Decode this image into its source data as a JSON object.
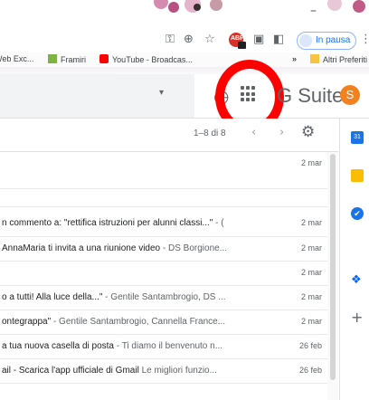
{
  "browser": {
    "window_controls": {
      "minimize": "–"
    },
    "omnibox_icons": {
      "key": "⚿",
      "zoom": "⊕",
      "star": "☆",
      "ext_red_text": "ABP",
      "ext_gray1": "▣",
      "ext_gray2": "◧",
      "menu": "⋮"
    },
    "profile": {
      "status_label": "In pausa"
    },
    "bookmarks": [
      {
        "label": "Web Exc...",
        "icon_color": "#ffffff"
      },
      {
        "label": "Framiri",
        "icon_color": "#7cb342"
      },
      {
        "label": "YouTube - Broadcas...",
        "icon_color": "#ff0000"
      }
    ],
    "bookmarks_overflow": "»",
    "other_bookmarks": "Altri Preferiti"
  },
  "gmail": {
    "header": {
      "search_dropdown_icon": "▾",
      "help_icon_partial": "◷",
      "apps_icon": "apps-grid-icon",
      "brand": "G Suite",
      "user_initial": "S",
      "avatar_color": "#f4811f"
    },
    "toolbar": {
      "paging": "1–8 di 8",
      "prev": "‹",
      "next": "›",
      "settings": "⚙"
    },
    "messages": [
      {
        "subject": "",
        "snippet": "",
        "date": "2 mar"
      },
      {
        "subject": "",
        "snippet": "",
        "date": ""
      },
      {
        "subject": "n commento a: \"rettifica istruzioni per alunni classi...\"",
        "snippet": " - (",
        "date": "2 mar"
      },
      {
        "subject": "AnnaMaria ti invita a una riunione video",
        "snippet": " - DS Borgione...",
        "date": "2 mar"
      },
      {
        "subject": "",
        "snippet": "",
        "date": "2 mar"
      },
      {
        "subject": "o a tutti! Alla luce della...\"",
        "snippet": " - Gentile Santambrogio, DS ...",
        "date": "2 mar"
      },
      {
        "subject": "ontegrappa\"",
        "snippet": " - Gentile Santambrogio, Cannella France...",
        "date": "2 mar"
      },
      {
        "subject": "a tua nuova casella di posta",
        "snippet": " - Ti diamo il benvenuto n...",
        "date": "26 feb"
      },
      {
        "subject": "ail - Scarica l'app ufficiale di Gmail",
        "snippet": " Le migliori funzio...",
        "date": "26 feb"
      }
    ]
  },
  "side_panel": {
    "calendar_label": "31",
    "tasks_glyph": "✔",
    "dropbox_glyph": "❖",
    "add_glyph": "+"
  }
}
